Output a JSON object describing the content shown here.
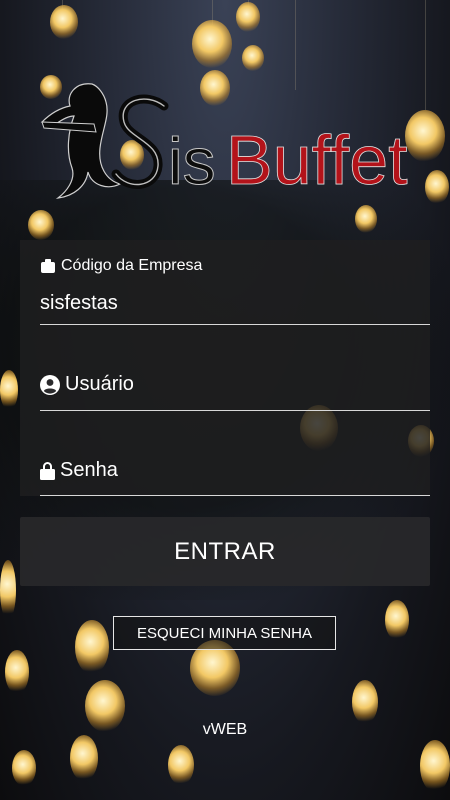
{
  "brand": {
    "logo_text_part1": "Sis",
    "logo_text_part2": "Buffet",
    "accent_color": "#c0141a"
  },
  "form": {
    "company": {
      "label": "Código da Empresa",
      "value": "sisfestas",
      "icon": "briefcase-icon"
    },
    "user": {
      "label": "Usuário",
      "value": "",
      "icon": "user-circle-icon"
    },
    "password": {
      "label": "Senha",
      "value": "",
      "icon": "lock-icon"
    }
  },
  "actions": {
    "enter_label": "ENTRAR",
    "forgot_label": "ESQUECI MINHA SENHA"
  },
  "footer": {
    "version": "vWEB"
  }
}
